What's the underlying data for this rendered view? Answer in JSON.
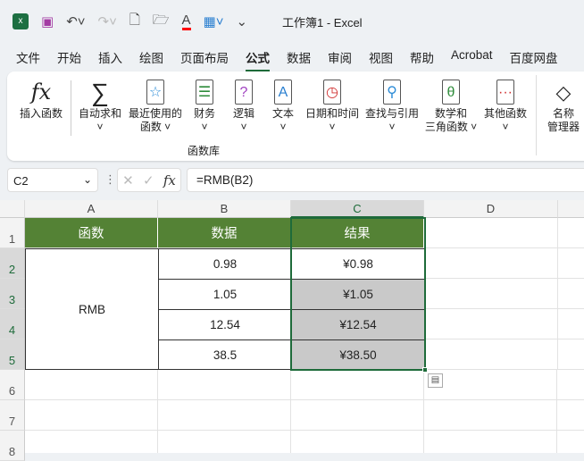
{
  "title": "工作簿1  -  Excel",
  "menu": [
    "文件",
    "开始",
    "插入",
    "绘图",
    "页面布局",
    "公式",
    "数据",
    "审阅",
    "视图",
    "帮助",
    "Acrobat",
    "百度网盘"
  ],
  "ribbon": {
    "insert_function": "插入函数",
    "autosum": "自动求和",
    "recent": "最近使用的",
    "recent2": "函数",
    "financial": "财务",
    "logical": "逻辑",
    "text": "文本",
    "datetime": "日期和时间",
    "lookup": "查找与引用",
    "math": "数学和",
    "math2": "三角函数",
    "more": "其他函数",
    "name_mgr": "名称",
    "name_mgr2": "管理器",
    "group": "函数库"
  },
  "namebox": "C2",
  "formula": "=RMB(B2)",
  "columns": [
    "A",
    "B",
    "C",
    "D"
  ],
  "rows": [
    "1",
    "2",
    "3",
    "4",
    "5",
    "6",
    "7",
    "8"
  ],
  "table": {
    "headers": [
      "函数",
      "数据",
      "结果"
    ],
    "func": "RMB",
    "data": [
      "0.98",
      "1.05",
      "12.54",
      "38.5"
    ],
    "result": [
      "¥0.98",
      "¥1.05",
      "¥12.54",
      "¥38.50"
    ]
  },
  "colors": {
    "header": "#548235",
    "accent": "#1e6b3a",
    "fill": "#c9c9c9"
  }
}
